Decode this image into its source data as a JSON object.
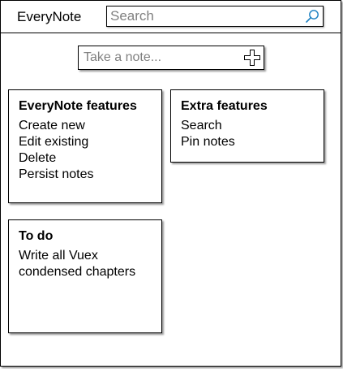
{
  "header": {
    "app_title": "EveryNote",
    "search": {
      "placeholder": "Search",
      "value": ""
    },
    "icons": {
      "search": "search-icon"
    }
  },
  "composer": {
    "placeholder": "Take a note...",
    "icon": "add-icon"
  },
  "notes": [
    {
      "title": "EveryNote features",
      "lines": [
        "Create new",
        "Edit existing",
        "Delete",
        "Persist notes"
      ]
    },
    {
      "title": "Extra features",
      "lines": [
        "Search",
        "Pin notes"
      ]
    },
    {
      "title": "To do",
      "lines": [
        "Write all Vuex",
        "condensed chapters"
      ]
    }
  ],
  "colors": {
    "border": "#000000",
    "search_icon": "#1a7fc1",
    "placeholder": "#808080",
    "shadow": "#9a9a9a"
  }
}
